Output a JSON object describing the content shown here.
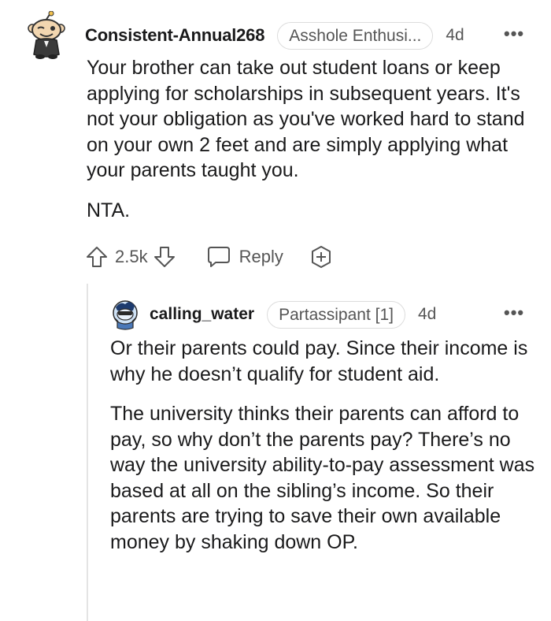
{
  "comment": {
    "username": "Consistent-Annual268",
    "flair": "Asshole Enthusi...",
    "age": "4d",
    "more": "•••",
    "paragraphs": [
      "Your brother can take out student loans or keep applying for scholarships in subsequent years. It's not your obligation as you've worked hard to stand on your own 2 feet and are simply applying what your parents taught you.",
      "NTA."
    ],
    "score": "2.5k",
    "reply_label": "Reply",
    "icons": {
      "upvote": "upvote-icon",
      "downvote": "downvote-icon",
      "reply": "reply-bubble-icon",
      "award": "award-plus-icon",
      "more": "more-icon"
    }
  },
  "reply": {
    "username": "calling_water",
    "flair": "Partassipant [1]",
    "age": "4d",
    "more": "•••",
    "paragraphs": [
      "Or their parents could pay. Since their income is why he doesn’t qualify for student aid.",
      "The university thinks their parents can afford to pay, so why don’t the parents pay? There’s no way the university ability-to-pay assessment was based at all on the sibling’s income. So their parents are trying to save their own available money by shaking down OP."
    ]
  }
}
